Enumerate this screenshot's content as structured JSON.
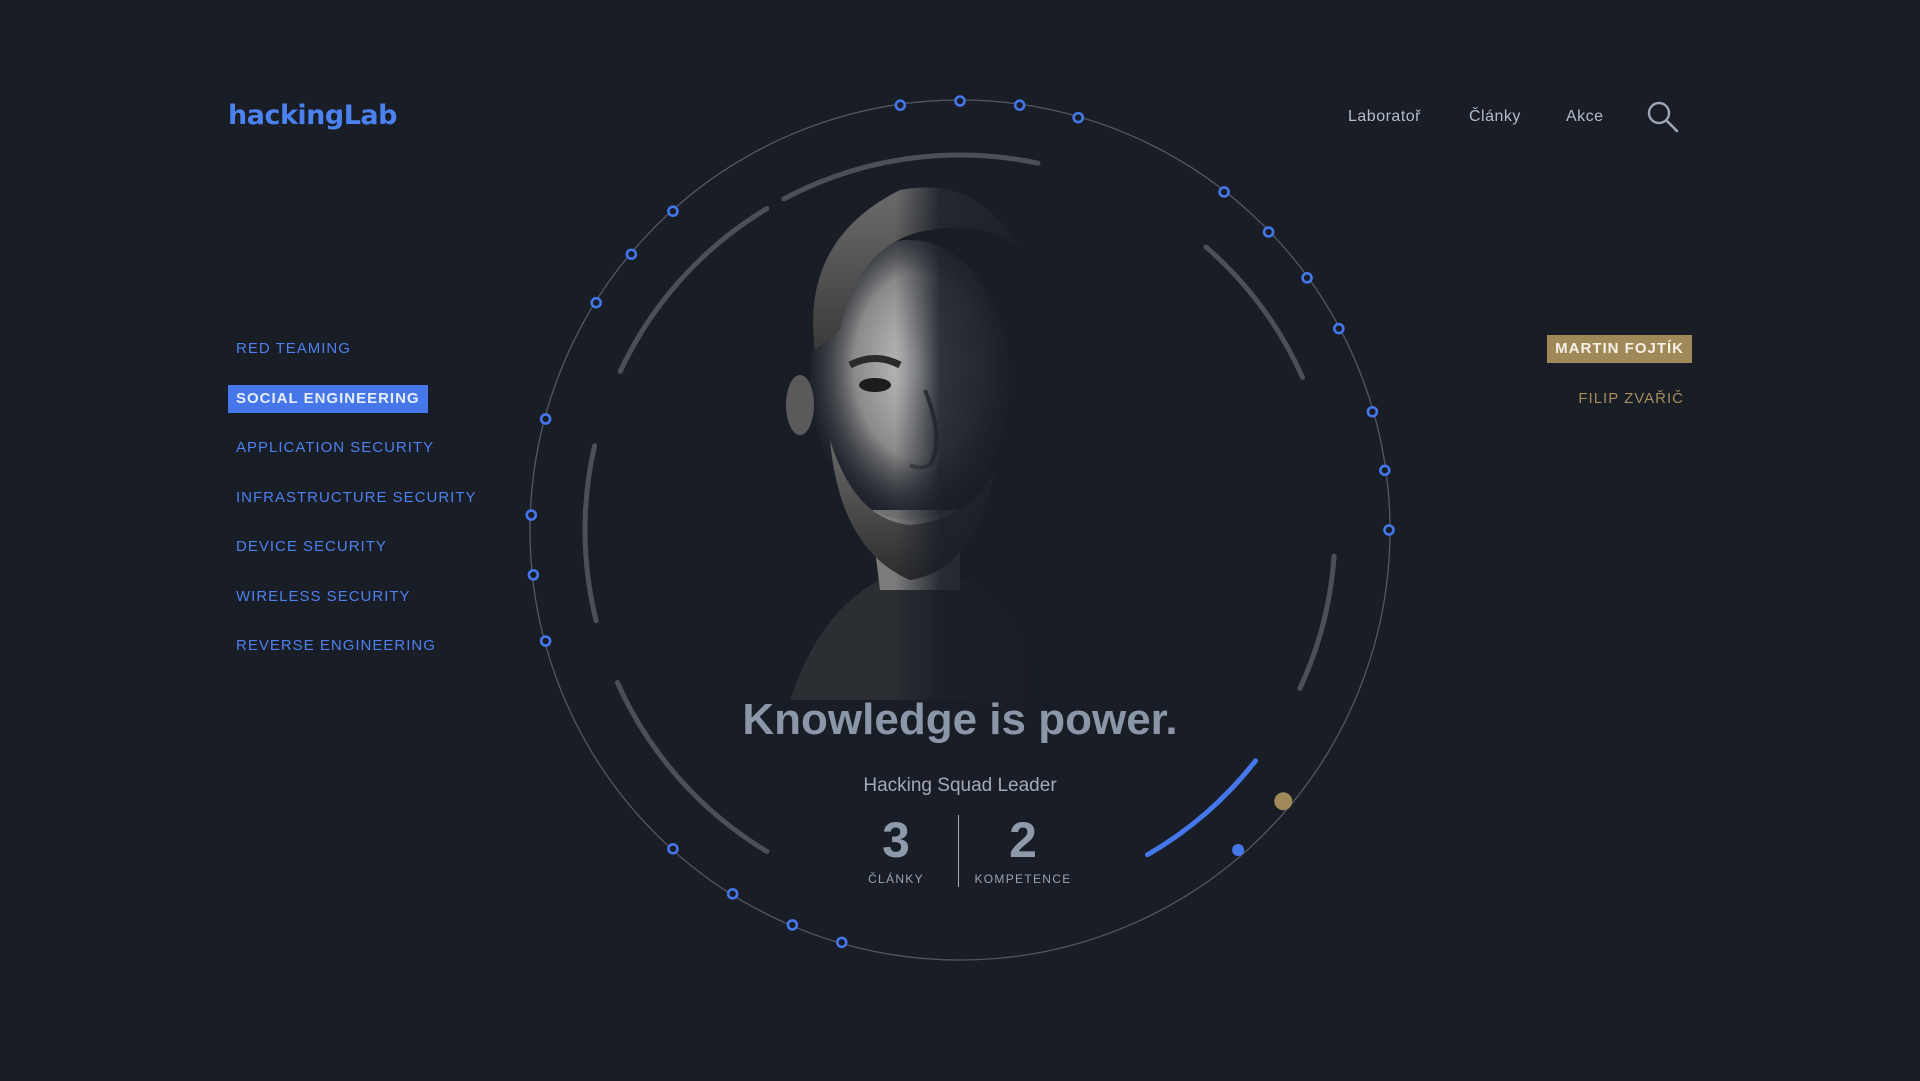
{
  "header": {
    "logo": "hackingLab",
    "nav": [
      {
        "label": "Laboratoř"
      },
      {
        "label": "Články"
      },
      {
        "label": "Akce"
      }
    ]
  },
  "categories": [
    {
      "label": "RED TEAMING",
      "active": false
    },
    {
      "label": "SOCIAL ENGINEERING",
      "active": true
    },
    {
      "label": "APPLICATION SECURITY",
      "active": false
    },
    {
      "label": "INFRASTRUCTURE SECURITY",
      "active": false
    },
    {
      "label": "DEVICE SECURITY",
      "active": false
    },
    {
      "label": "WIRELESS SECURITY",
      "active": false
    },
    {
      "label": "REVERSE ENGINEERING",
      "active": false
    }
  ],
  "people": [
    {
      "name": "MARTIN FOJTÍK",
      "active": true
    },
    {
      "name": "FILIP ZVAŘIČ",
      "active": false
    }
  ],
  "profile": {
    "quote": "Knowledge is power.",
    "role": "Hacking Squad Leader",
    "stats": [
      {
        "value": "3",
        "label": "ČLÁNKY"
      },
      {
        "value": "2",
        "label": "KOMPETENCE"
      }
    ]
  },
  "colors": {
    "background": "#181d26",
    "accent_blue": "#4577ea",
    "accent_gold": "#a08959",
    "ring_gray": "#4a4f58"
  }
}
